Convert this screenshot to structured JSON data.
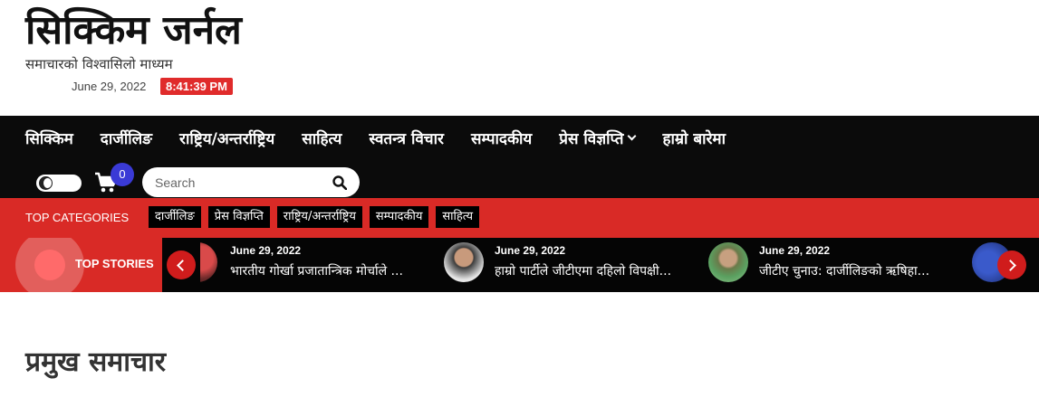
{
  "header": {
    "site_title": "सिक्किम जर्नल",
    "tagline": "समाचारको विश्वासिलो माध्यम",
    "date": "June 29, 2022",
    "time": "8:41:39 PM"
  },
  "nav": {
    "items": [
      {
        "label": "सिक्किम"
      },
      {
        "label": "दार्जीलिङ"
      },
      {
        "label": "राष्ट्रिय/अन्तर्राष्ट्रिय"
      },
      {
        "label": "साहित्य"
      },
      {
        "label": "स्वतन्त्र विचार"
      },
      {
        "label": "सम्पादकीय"
      },
      {
        "label": "प्रेस विज्ञप्ति"
      },
      {
        "label": "हाम्रो बारेमा"
      }
    ],
    "cart_count": "0",
    "search_placeholder": "Search"
  },
  "categories": {
    "label": "TOP CATEGORIES",
    "items": [
      "दार्जीलिङ",
      "प्रेस विज्ञप्ति",
      "राष्ट्रिय/अन्तर्राष्ट्रिय",
      "सम्पादकीय",
      "साहित्य"
    ]
  },
  "top_stories": {
    "label": "TOP STORIES",
    "items": [
      {
        "date": "June 29, 2022",
        "title": "भारतीय गोर्खा प्रजातान्त्रिक मोर्चाले ..."
      },
      {
        "date": "June 29, 2022",
        "title": "हाम्रो पार्टीले जीटीएमा दहिलो विपक्षी..."
      },
      {
        "date": "June 29, 2022",
        "title": "जीटीए चुनाउ: दार्जीलिङको ऋषिहा..."
      }
    ]
  },
  "main": {
    "section_title": "प्रमुख समाचार"
  },
  "colors": {
    "accent": "#d92a26",
    "nav_bg": "#0b0b0b",
    "cart_badge": "#3a3ad6"
  }
}
